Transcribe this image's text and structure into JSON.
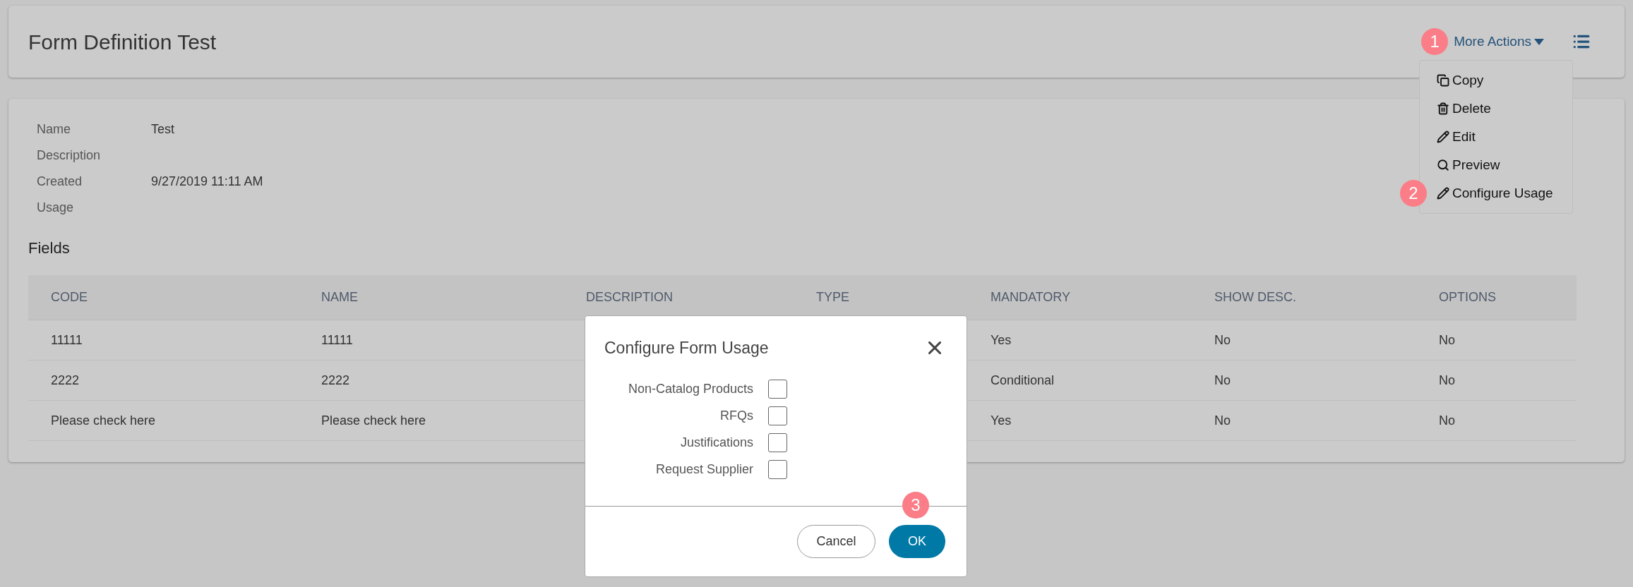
{
  "header": {
    "title": "Form Definition Test",
    "more_actions": "More Actions",
    "step_badge": "1"
  },
  "dropdown": {
    "items": [
      {
        "label": "Copy",
        "kind": "copy"
      },
      {
        "label": "Delete",
        "kind": "delete"
      },
      {
        "label": "Edit",
        "kind": "edit"
      },
      {
        "label": "Preview",
        "kind": "preview"
      },
      {
        "label": "Configure Usage",
        "kind": "edit",
        "badge": "2"
      }
    ]
  },
  "details": [
    {
      "label": "Name",
      "value": "Test"
    },
    {
      "label": "Description"
    },
    {
      "label": "Created",
      "value": "9/27/2019 11:11 AM"
    },
    {
      "label": "Usage"
    }
  ],
  "fields": {
    "title": "Fields",
    "columns": [
      "CODE",
      "NAME",
      "DESCRIPTION",
      "TYPE",
      "MANDATORY",
      "SHOW DESC.",
      "OPTIONS"
    ],
    "rows": [
      {
        "code": "11111",
        "name": "11111",
        "mandatory": "Yes",
        "show_desc": "No",
        "options": "No"
      },
      {
        "code": "2222",
        "name": "2222",
        "mandatory": "Conditional",
        "show_desc": "No",
        "options": "No"
      },
      {
        "code": "Please check here",
        "name": "Please check here",
        "mandatory": "Yes",
        "show_desc": "No",
        "options": "No"
      }
    ]
  },
  "modal": {
    "title": "Configure Form Usage",
    "options": [
      {
        "label": "Non-Catalog Products",
        "checked": false
      },
      {
        "label": "RFQs",
        "checked": false
      },
      {
        "label": "Justifications",
        "checked": false
      },
      {
        "label": "Request Supplier",
        "checked": false
      }
    ],
    "cancel": "Cancel",
    "ok": "OK",
    "step_badge": "3"
  }
}
